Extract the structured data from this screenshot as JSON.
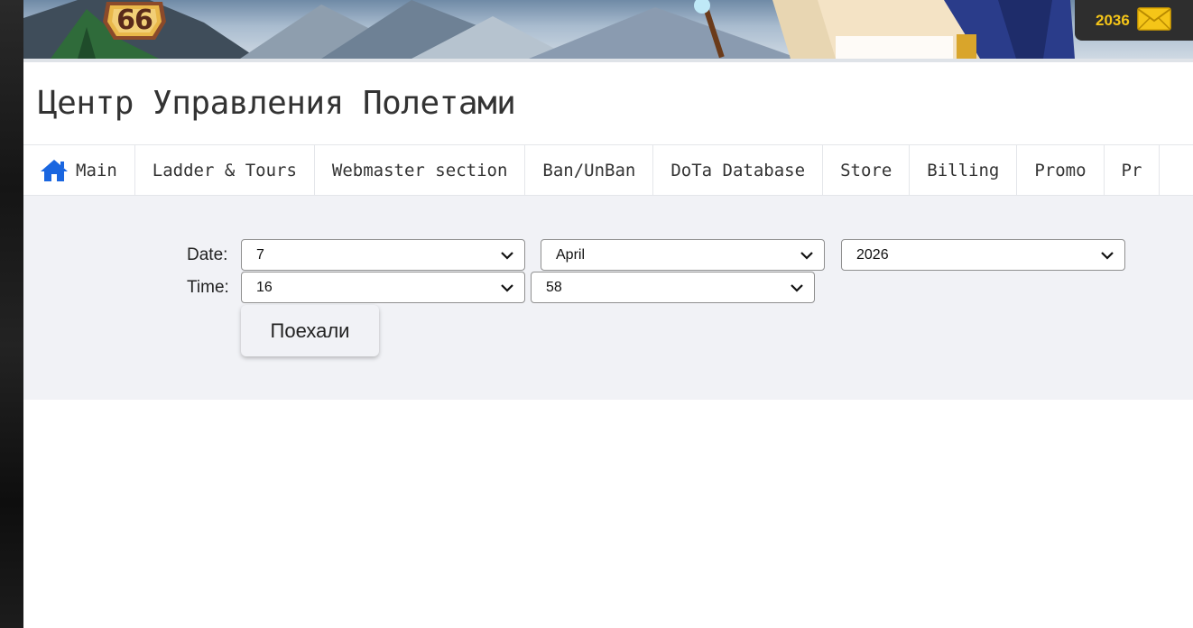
{
  "banner": {
    "level": "66",
    "mail_count": "2036",
    "icons": {
      "mail": "envelope-icon"
    }
  },
  "page": {
    "title": "Центр Управления Полетами"
  },
  "nav": {
    "items": [
      {
        "label": "Main",
        "icon": "home-icon"
      },
      {
        "label": "Ladder & Tours"
      },
      {
        "label": "Webmaster section"
      },
      {
        "label": "Ban/UnBan"
      },
      {
        "label": "DoTa Database"
      },
      {
        "label": "Store"
      },
      {
        "label": "Billing"
      },
      {
        "label": "Promo"
      },
      {
        "label": "Pr"
      }
    ]
  },
  "form": {
    "date_label": "Date:",
    "time_label": "Time:",
    "day": "7",
    "month": "April",
    "year": "2026",
    "hour": "16",
    "minute": "58",
    "submit_label": "Поехали"
  },
  "colors": {
    "nav_icon": "#1a66e0",
    "mail_count": "#f5c518",
    "panel_bg": "#f1f2f6"
  }
}
